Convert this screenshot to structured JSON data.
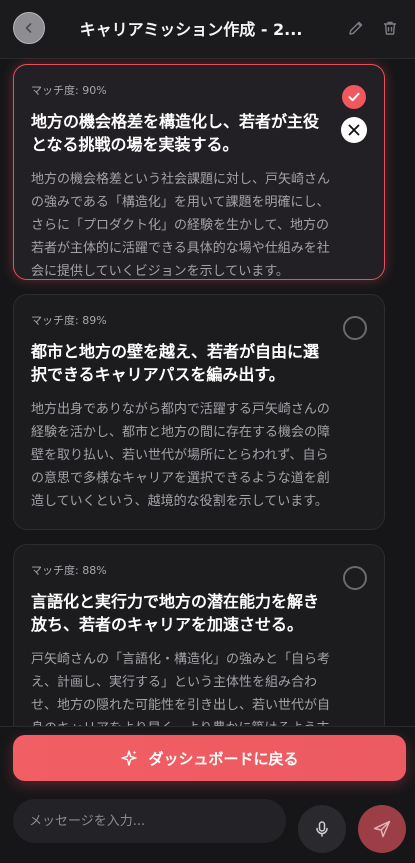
{
  "header": {
    "title": "キャリアミッション作成 - 2..."
  },
  "cards": [
    {
      "match": "マッチ度: 90%",
      "title": "地方の機会格差を構造化し、若者が主役となる挑戦の場を実装する。",
      "description": "地方の機会格差という社会課題に対し、戸矢崎さんの強みである「構造化」を用いて課題を明確にし、さらに「プロダクト化」の経験を生かして、地方の若者が主体的に活躍できる具体的な場や仕組みを社会に提供していくビジョンを示しています。",
      "selected": true
    },
    {
      "match": "マッチ度: 89%",
      "title": "都市と地方の壁を越え、若者が自由に選択できるキャリアパスを編み出す。",
      "description": "地方出身でありながら都内で活躍する戸矢崎さんの経験を活かし、都市と地方の間に存在する機会の障壁を取り払い、若い世代が場所にとらわれず、自らの意思で多様なキャリアを選択できるような道を創造していくという、越境的な役割を示しています。",
      "selected": false
    },
    {
      "match": "マッチ度: 88%",
      "title": "言語化と実行力で地方の潜在能力を解き放ち、若者のキャリアを加速させる。",
      "description": "戸矢崎さんの「言語化・構造化」の強みと「自ら考え、計画し、実行する」という主体性を組み合わせ、地方の隠れた可能性を引き出し、若い世代が自身のキャリアをより早く、より豊かに築けるよう支援す",
      "selected": false
    }
  ],
  "footer": {
    "dashboard_button": "ダッシュボードに戻る",
    "input_placeholder": "メッセージを入力..."
  },
  "colors": {
    "accent": "#f0575f",
    "background": "#161618",
    "card": "#1c1c1f"
  },
  "icons": {
    "back": "chevron-left-icon",
    "edit": "pencil-icon",
    "delete": "trash-icon",
    "selected": "check-icon",
    "share": "x-logo-icon",
    "dashboard": "sparkle-icon",
    "mic": "microphone-icon",
    "send": "send-icon"
  }
}
